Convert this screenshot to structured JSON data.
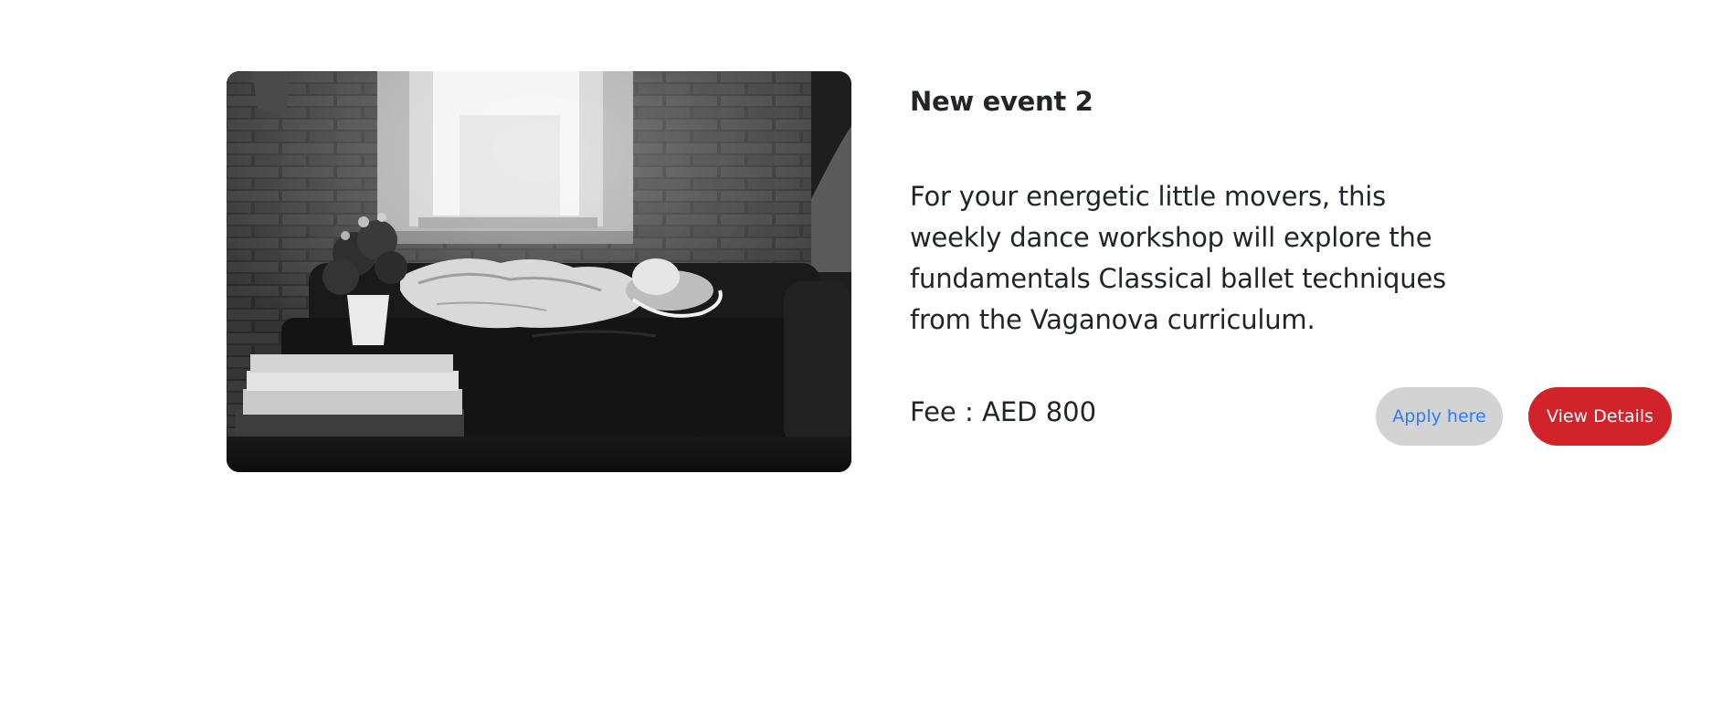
{
  "event": {
    "title": "New event 2",
    "description": "For your energetic little movers, this weekly dance workshop will explore the fundamentals Classical ballet techniques from the Vaganova curriculum.",
    "fee_label": "Fee : AED 800",
    "image_alt": "Black and white photo of a child sleeping on a sofa beneath a window",
    "apply_label": "Apply here",
    "view_label": "View Details"
  },
  "colors": {
    "apply_bg": "#d3d3d3",
    "apply_text": "#2f7cf6",
    "view_bg": "#d2232a",
    "view_text": "#ffffff"
  }
}
